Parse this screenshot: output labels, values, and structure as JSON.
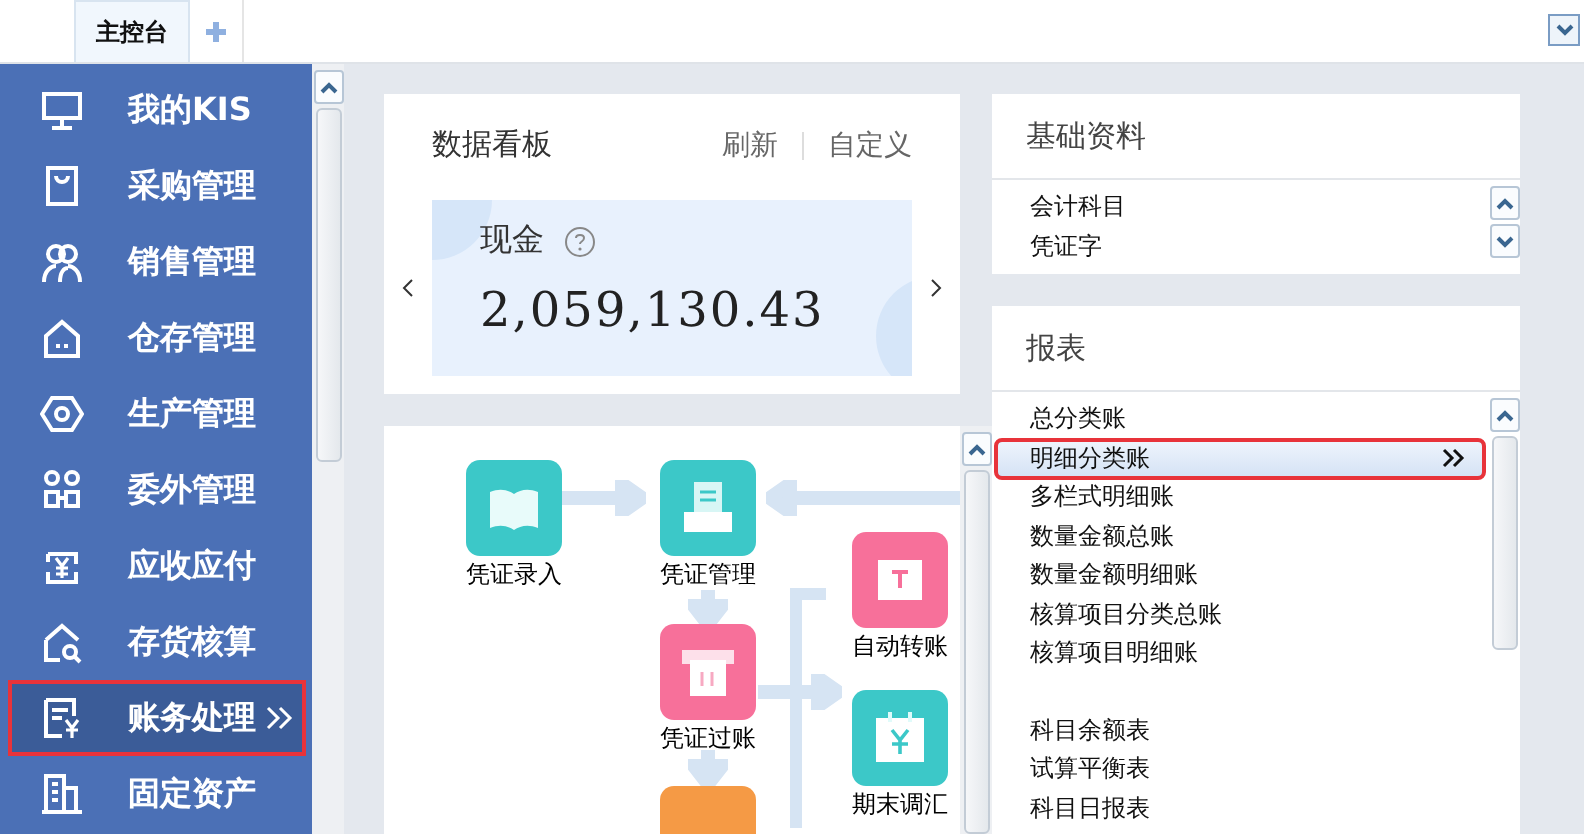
{
  "tabs": [
    {
      "label": "主控台",
      "selected": true
    }
  ],
  "sidebar": {
    "items": [
      {
        "label": "我的KIS",
        "selected": false
      },
      {
        "label": "采购管理",
        "selected": false
      },
      {
        "label": "销售管理",
        "selected": false
      },
      {
        "label": "仓存管理",
        "selected": false
      },
      {
        "label": "生产管理",
        "selected": false
      },
      {
        "label": "委外管理",
        "selected": false
      },
      {
        "label": "应收应付",
        "selected": false
      },
      {
        "label": "存货核算",
        "selected": false
      },
      {
        "label": "账务处理",
        "selected": true
      },
      {
        "label": "固定资产",
        "selected": false
      }
    ]
  },
  "dashboard": {
    "title": "数据看板",
    "actions": [
      "刷新",
      "自定义"
    ],
    "metric": {
      "label": "现金",
      "value": "2,059,130.43"
    }
  },
  "flow": {
    "nodes": [
      {
        "label": "凭证录入",
        "color": "#3cc8c8"
      },
      {
        "label": "凭证管理",
        "color": "#3cc8c8"
      },
      {
        "label": "自动转账",
        "color": "#f7709a"
      },
      {
        "label": "凭证过账",
        "color": "#f7709a"
      },
      {
        "label": "期末调汇",
        "color": "#3cc8c8"
      },
      {
        "color": "#f59a45"
      }
    ]
  },
  "basic": {
    "title": "基础资料",
    "items": [
      "会计科目",
      "凭证字"
    ]
  },
  "reports": {
    "title": "报表",
    "groups": [
      [
        {
          "label": "总分类账",
          "selected": false
        },
        {
          "label": "明细分类账",
          "selected": true
        },
        {
          "label": "多栏式明细账",
          "selected": false
        },
        {
          "label": "数量金额总账",
          "selected": false
        },
        {
          "label": "数量金额明细账",
          "selected": false
        },
        {
          "label": "核算项目分类总账",
          "selected": false
        },
        {
          "label": "核算项目明细账",
          "selected": false
        }
      ],
      [
        {
          "label": "科目余额表",
          "selected": false
        },
        {
          "label": "试算平衡表",
          "selected": false
        },
        {
          "label": "科目日报表",
          "selected": false
        }
      ]
    ]
  }
}
